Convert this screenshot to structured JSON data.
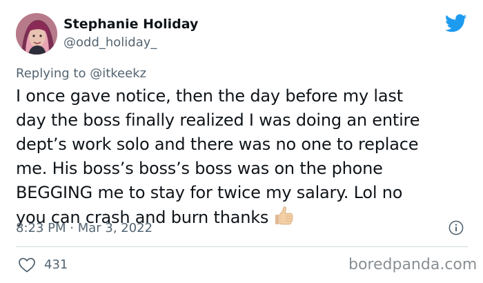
{
  "user": {
    "display_name": "Stephanie Holiday",
    "handle": "@odd_holiday_"
  },
  "reply_to": {
    "prefix": "Replying to",
    "mention": "@itkeekz"
  },
  "tweet": {
    "lines": [
      "I once gave notice, then the day before my last",
      "day the boss finally realized I was doing an entire",
      "dept’s work solo and there was no one to replace",
      "me. His boss’s boss’s boss was on the phone",
      "BEGGING me to stay for twice my salary. Lol no",
      "you can crash and burn thanks"
    ],
    "emoji": "thumbs-up-light-skin"
  },
  "meta": {
    "timestamp": "8:23 PM · Mar 3, 2022"
  },
  "engagement": {
    "likes": "431"
  },
  "watermark": "boredpanda.com",
  "colors": {
    "twitter_blue": "#1d9bf0",
    "secondary_text": "#536471",
    "primary_text": "#0f1419"
  },
  "icons": {
    "brand": "twitter-bird-icon",
    "info": "info-icon",
    "like": "heart-icon"
  }
}
